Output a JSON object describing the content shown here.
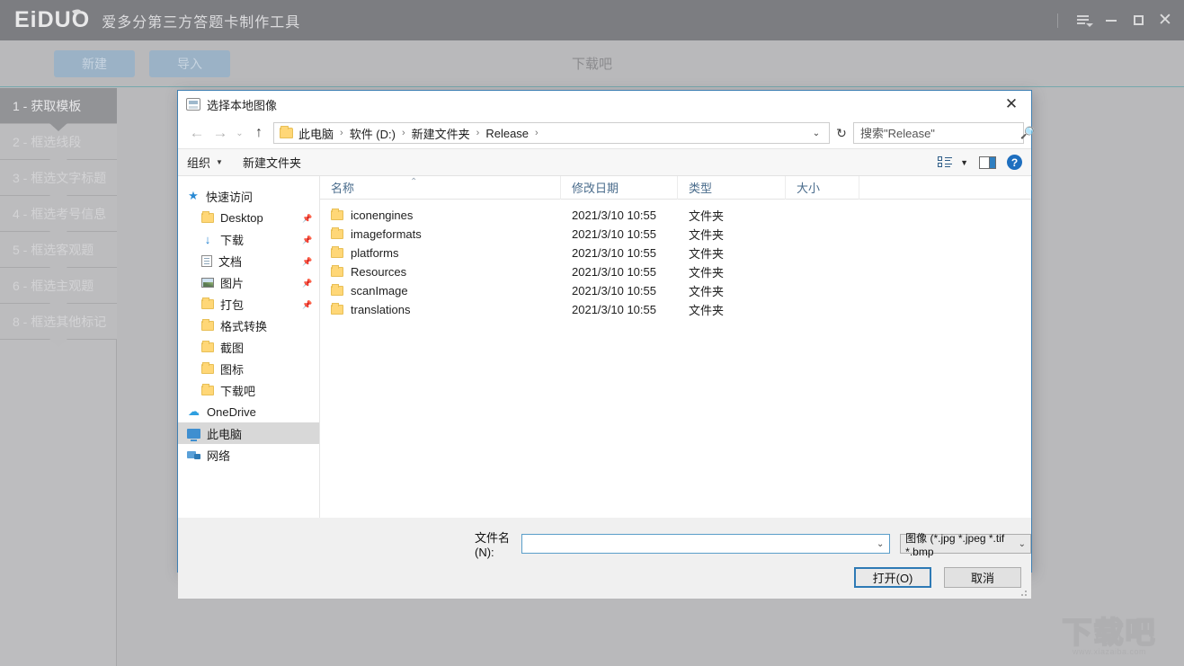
{
  "app": {
    "logo": "EiDUO",
    "title": "爱多分第三方答题卡制作工具",
    "center_brand": "下载吧",
    "titlebar_buttons": {
      "menu": "menu-icon",
      "minimize": "−",
      "maximize": "□",
      "close": "✕"
    },
    "toolbar": {
      "new_label": "新建",
      "import_label": "导入"
    },
    "steps": [
      {
        "label": "1 - 获取模板",
        "active": true
      },
      {
        "label": "2 - 框选线段",
        "active": false
      },
      {
        "label": "3 - 框选文字标题",
        "active": false
      },
      {
        "label": "4 - 框选考号信息",
        "active": false
      },
      {
        "label": "5 - 框选客观题",
        "active": false
      },
      {
        "label": "6 - 框选主观题",
        "active": false
      },
      {
        "label": "8 - 框选其他标记",
        "active": false
      }
    ],
    "watermark": {
      "text": "下载吧",
      "url": "www.xiazaiba.com"
    }
  },
  "dialog": {
    "title": "选择本地图像",
    "close_label": "✕",
    "nav": {
      "back": "←",
      "forward": "→",
      "history": "⌄",
      "up": "↑",
      "breadcrumb": [
        "此电脑",
        "软件 (D:)",
        "新建文件夹",
        "Release"
      ],
      "breadcrumb_trailing_sep": "›",
      "address_caret": "⌄",
      "refresh": "↻"
    },
    "search": {
      "placeholder": "搜索\"Release\"",
      "value": "",
      "icon": "search-icon"
    },
    "toolbar2": {
      "organize_label": "组织",
      "organize_caret": "▼",
      "new_folder_label": "新建文件夹",
      "view_caret": "▼",
      "help_label": "?"
    },
    "nav_pane": [
      {
        "label": "快速访问",
        "icon": "star-icon",
        "indent": false,
        "pinned": false,
        "selected": false
      },
      {
        "label": "Desktop",
        "icon": "folder-icon",
        "indent": true,
        "pinned": true,
        "selected": false
      },
      {
        "label": "下载",
        "icon": "download-icon",
        "indent": true,
        "pinned": true,
        "selected": false
      },
      {
        "label": "文档",
        "icon": "document-icon",
        "indent": true,
        "pinned": true,
        "selected": false
      },
      {
        "label": "图片",
        "icon": "picture-icon",
        "indent": true,
        "pinned": true,
        "selected": false
      },
      {
        "label": "打包",
        "icon": "folder-icon",
        "indent": true,
        "pinned": true,
        "selected": false
      },
      {
        "label": "格式转换",
        "icon": "folder-icon",
        "indent": true,
        "pinned": false,
        "selected": false
      },
      {
        "label": "截图",
        "icon": "folder-icon",
        "indent": true,
        "pinned": false,
        "selected": false
      },
      {
        "label": "图标",
        "icon": "folder-icon",
        "indent": true,
        "pinned": false,
        "selected": false
      },
      {
        "label": "下载吧",
        "icon": "folder-icon",
        "indent": true,
        "pinned": false,
        "selected": false
      },
      {
        "label": "OneDrive",
        "icon": "cloud-icon",
        "indent": false,
        "pinned": false,
        "selected": false
      },
      {
        "label": "此电脑",
        "icon": "computer-icon",
        "indent": false,
        "pinned": false,
        "selected": true
      },
      {
        "label": "网络",
        "icon": "network-icon",
        "indent": false,
        "pinned": false,
        "selected": false
      }
    ],
    "columns": [
      "名称",
      "修改日期",
      "类型",
      "大小"
    ],
    "sort_indicator": "⌃",
    "files": [
      {
        "name": "iconengines",
        "date": "2021/3/10 10:55",
        "type": "文件夹",
        "size": ""
      },
      {
        "name": "imageformats",
        "date": "2021/3/10 10:55",
        "type": "文件夹",
        "size": ""
      },
      {
        "name": "platforms",
        "date": "2021/3/10 10:55",
        "type": "文件夹",
        "size": ""
      },
      {
        "name": "Resources",
        "date": "2021/3/10 10:55",
        "type": "文件夹",
        "size": ""
      },
      {
        "name": "scanImage",
        "date": "2021/3/10 10:55",
        "type": "文件夹",
        "size": ""
      },
      {
        "name": "translations",
        "date": "2021/3/10 10:55",
        "type": "文件夹",
        "size": ""
      }
    ],
    "footer": {
      "filename_label": "文件名(N):",
      "filename_value": "",
      "filetype_value": "图像 (*.jpg *.jpeg *.tif *.bmp",
      "filetype_caret": "⌄",
      "open_label": "打开(O)",
      "cancel_label": "取消"
    }
  },
  "colors": {
    "titlebar": "#7c7d81",
    "toolbar": "#b9b9bb",
    "accent_line": "#76a8ad",
    "step_active": "#929396",
    "dialog_border": "#3f7fb2",
    "primary_button_border": "#2e7ab5",
    "help_blue": "#1e6fbf",
    "folder_yellow": "#ffd777"
  }
}
